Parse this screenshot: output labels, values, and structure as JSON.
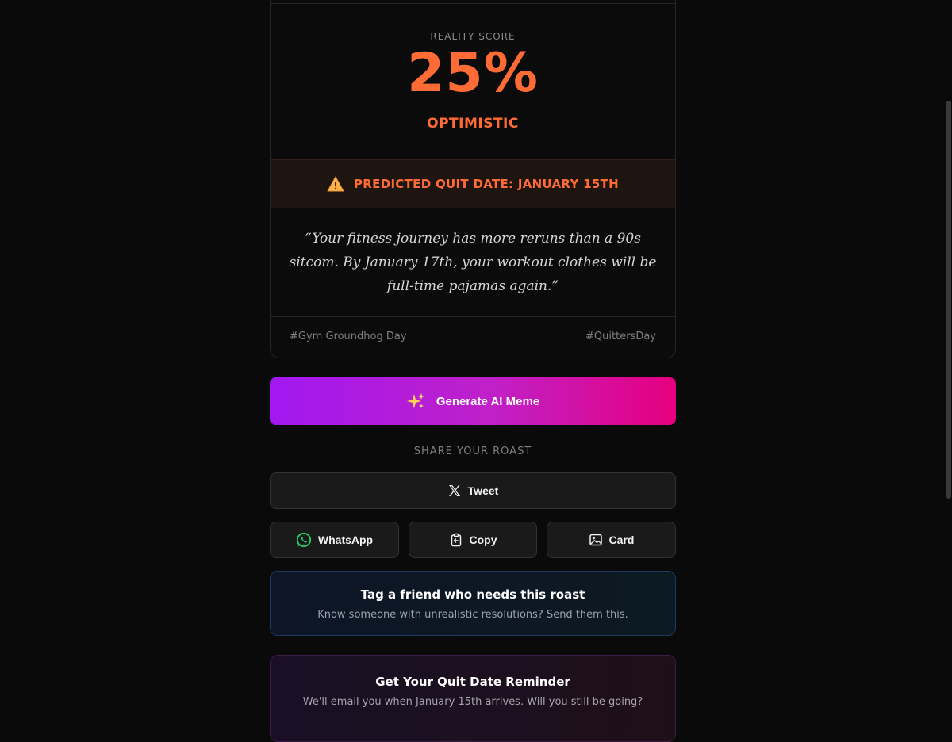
{
  "score": {
    "label": "REALITY SCORE",
    "value": "25%",
    "verdict": "OPTIMISTIC",
    "accent_color": "#ff6b35"
  },
  "quit_banner": {
    "icon": "warning-icon",
    "text": "PREDICTED QUIT DATE: JANUARY 15TH"
  },
  "roast": {
    "quote": "“Your fitness journey has more reruns than a 90s sitcom. By January 17th, your workout clothes will be full-time pajamas again.”"
  },
  "tags": {
    "left": "#Gym Groundhog Day",
    "right": "#QuittersDay"
  },
  "meme_button": {
    "icon": "sparkles-icon",
    "label": "Generate AI Meme",
    "gradient_start": "#a118f0",
    "gradient_end": "#e6007e"
  },
  "share": {
    "label": "SHARE YOUR ROAST",
    "tweet": {
      "icon": "x-logo-icon",
      "label": "Tweet"
    },
    "whatsapp": {
      "icon": "whatsapp-icon",
      "label": "WhatsApp",
      "color": "#25d366"
    },
    "copy": {
      "icon": "clipboard-icon",
      "label": "Copy"
    },
    "card": {
      "icon": "image-icon",
      "label": "Card"
    }
  },
  "friend_cta": {
    "title": "Tag a friend who needs this roast",
    "subtitle": "Know someone with unrealistic resolutions? Send them this."
  },
  "reminder": {
    "title": "Get Your Quit Date Reminder",
    "subtitle": "We'll email you when January 15th arrives. Will you still be going?"
  }
}
